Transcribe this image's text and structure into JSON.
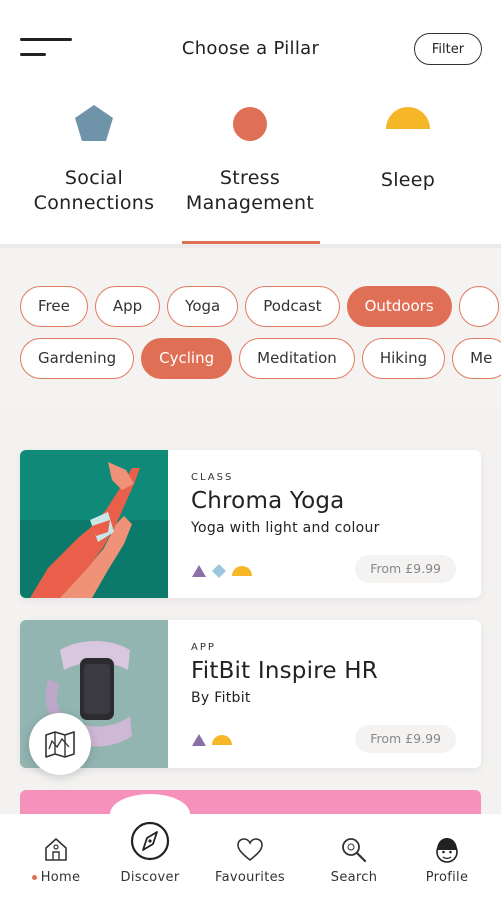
{
  "header": {
    "title": "Choose a Pillar",
    "filter_label": "Filter"
  },
  "pillars": [
    {
      "label_line1": "Social",
      "label_line2": "Connections",
      "color": "#6f93a8",
      "shape": "pentagon"
    },
    {
      "label_line1": "Stress",
      "label_line2": "Management",
      "color": "#e07055",
      "shape": "circle",
      "selected": true
    },
    {
      "label_line1": "Sleep",
      "color": "#f5b728",
      "shape": "semicircle"
    }
  ],
  "chips": {
    "row1": [
      {
        "label": "Free"
      },
      {
        "label": "App"
      },
      {
        "label": "Yoga"
      },
      {
        "label": "Podcast"
      },
      {
        "label": "Outdoors",
        "active": true
      }
    ],
    "row2": [
      {
        "label": "Gardening"
      },
      {
        "label": "Cycling",
        "active": true
      },
      {
        "label": "Meditation"
      },
      {
        "label": "Hiking"
      },
      {
        "label": "Me"
      }
    ]
  },
  "cards": [
    {
      "kind": "CLASS",
      "name": "Chroma Yoga",
      "subtitle": "Yoga with light and colour",
      "price": "From £9.99",
      "icons": [
        "triangle-icon",
        "diamond-icon",
        "semicircle-icon"
      ]
    },
    {
      "kind": "APP",
      "name": "FitBit Inspire HR",
      "subtitle": "By Fitbit",
      "price": "From £9.99",
      "icons": [
        "triangle-icon",
        "semicircle-icon"
      ]
    }
  ],
  "tabs": [
    {
      "label": "Home",
      "icon": "home-icon",
      "active": true
    },
    {
      "label": "Discover",
      "icon": "compass-icon"
    },
    {
      "label": "Favourites",
      "icon": "heart-icon"
    },
    {
      "label": "Search",
      "icon": "search-icon"
    },
    {
      "label": "Profile",
      "icon": "profile-icon"
    }
  ],
  "colors": {
    "accent": "#e07055",
    "social": "#6f93a8",
    "sleep": "#f5b728",
    "activity_purple": "#8a6fa8",
    "activity_blue": "#9dc7df"
  }
}
